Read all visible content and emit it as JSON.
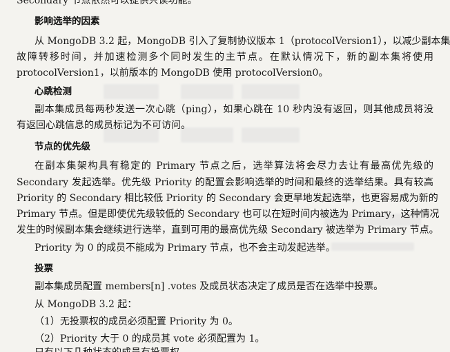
{
  "top_partial": "Secondary 节点依然可以提供只读功能。",
  "sections": [
    {
      "heading": "影响选举的因素",
      "lines": [
        "从 MongoDB 3.2 起，MongoDB 引入了复制协议版本 1（protocolVersion1），以减少副本集",
        "故障转移时间，并加速检测多个同时发生的主节点。在默认情况下，新的副本集将使用",
        "protocolVersion1，以前版本的 MongoDB 使用 protocolVersion0。"
      ]
    },
    {
      "heading": "心跳检测",
      "lines": [
        "副本集成员每两秒发送一次心跳（ping），如果心跳在 10 秒内没有返回，则其他成员将没",
        "有返回心跳信息的成员标记为不可访问。"
      ]
    },
    {
      "heading": "节点的优先级",
      "lines": [
        "在副本集架构具有稳定的 Primary 节点之后，选举算法将会尽力去让有最高优先级的",
        "Secondary 发起选举。优先级 Priority 的配置会影响选举的时间和最终的选举结果。具有较高",
        "Priority 的 Secondary 相比较低 Priority 的 Secondary 会更早地发起选举，也更容易成为新的",
        "Primary 节点。但是即使优先级较低的 Secondary 也可以在短时间内被选为 Primary，这种情况",
        "发生的时候副本集会继续进行选举，直到可用的最高优先级 Secondary 被选举为 Primary 节点。"
      ],
      "extra": "Priority 为 0 的成员不能成为 Primary 节点，也不会主动发起选举。"
    },
    {
      "heading": "投票",
      "lines": [
        "副本集成员配置 members[n] .votes 及成员状态决定了成员是否在选举中投票。",
        "从 MongoDB 3.2 起：",
        "（1）无投票权的成员必须配置 Priority 为 0。",
        "（2）Priority 大于 0 的成员其 vote 必须配置为 1。"
      ]
    }
  ],
  "bottom_partial": "只有以下几种状态的成员有投票权"
}
